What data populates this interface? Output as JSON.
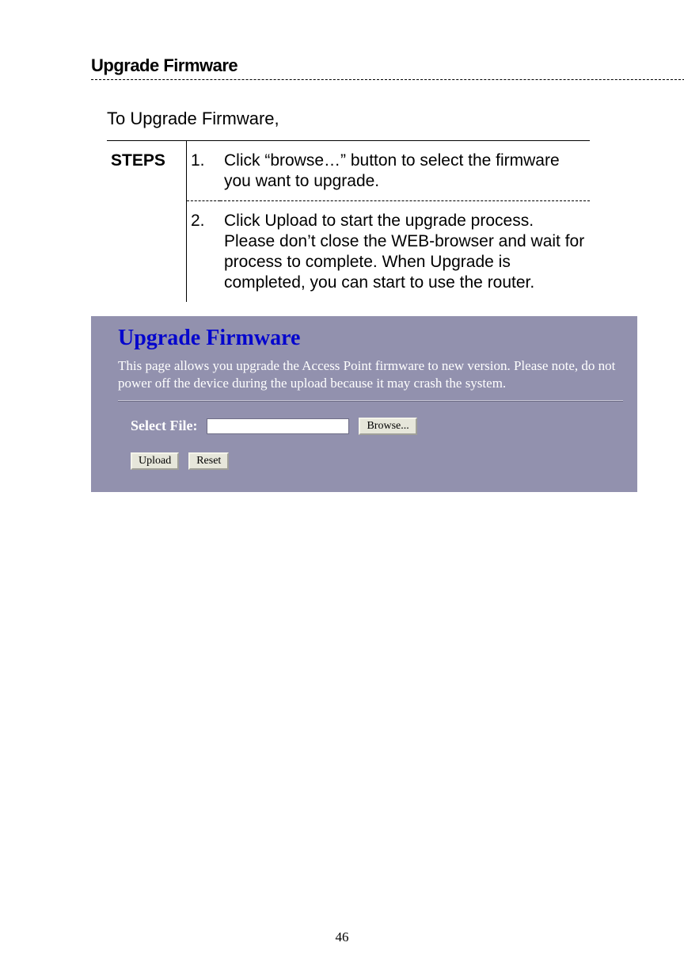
{
  "heading": "Upgrade Firmware",
  "intro": "To Upgrade Firmware,",
  "steps_label": "STEPS",
  "steps": [
    {
      "num": "1.",
      "text": "Click “browse…” button to select the firmware you want to upgrade."
    },
    {
      "num": "2.",
      "text": "Click Upload to start the upgrade process. Please don’t close the WEB-browser and wait for process to complete. When Upgrade is completed, you can start to use the router."
    }
  ],
  "panel": {
    "title": "Upgrade Firmware",
    "description": "This page allows you upgrade the Access Point firmware to new version. Please note, do not power off the device during the upload because it may crash the system.",
    "select_label": "Select File:",
    "file_value": "",
    "browse_label": "Browse...",
    "upload_label": "Upload",
    "reset_label": "Reset"
  },
  "page_number": "46"
}
